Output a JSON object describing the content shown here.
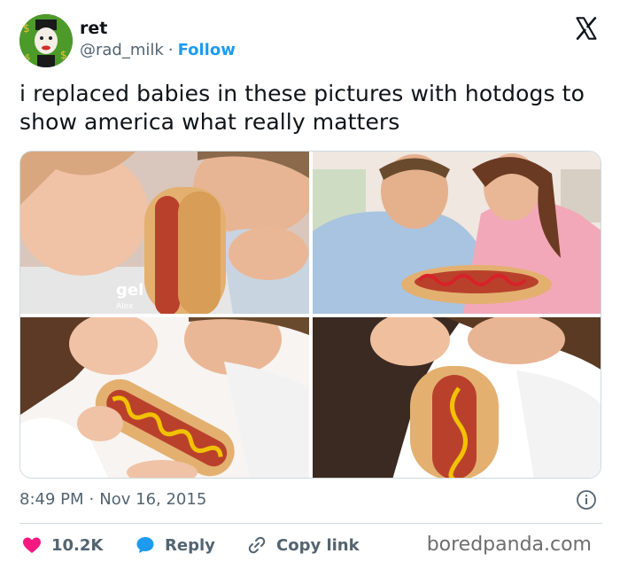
{
  "header": {
    "display_name": "ret",
    "handle": "@rad_milk",
    "separator": "·",
    "follow_label": "Follow",
    "avatar_icon": "clown-face-avatar",
    "close_icon": "x-logo-icon"
  },
  "tweet": {
    "text": "i replaced babies in these pictures with hotdogs to show america what really matters"
  },
  "media": {
    "images": [
      {
        "icon": "couple-with-hotdog-photo-1",
        "caption": "gel",
        "caption_sub": "Alex"
      },
      {
        "icon": "couple-with-hotdog-photo-2"
      },
      {
        "icon": "couple-with-hotdog-photo-3"
      },
      {
        "icon": "couple-with-hotdog-photo-4"
      }
    ]
  },
  "footer": {
    "time": "8:49 PM",
    "separator": "·",
    "date": "Nov 16, 2015",
    "info_icon": "info-icon"
  },
  "actions": {
    "likes": "10.2K",
    "reply_label": "Reply",
    "copy_label": "Copy link"
  },
  "watermark": "boredpanda.com",
  "colors": {
    "accent": "#1d9bf0",
    "like": "#f91880",
    "text": "#0f1419",
    "muted": "#536471"
  }
}
